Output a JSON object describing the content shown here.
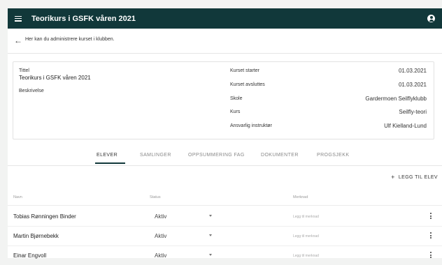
{
  "appbar": {
    "title": "Teorikurs i GSFK våren 2021",
    "menu_icon": "menu-icon",
    "account_icon": "account-circle-icon",
    "color": "#11383a"
  },
  "back": {
    "text": "Her kan du administrere kurset i klubben.",
    "icon": "arrow-left-icon"
  },
  "details": {
    "title_label": "Tittel",
    "title_value": "Teorikurs i GSFK våren 2021",
    "description_label": "Beskrivelse",
    "fields": [
      {
        "label": "Kurset starter",
        "value": "01.03.2021"
      },
      {
        "label": "Kurset avsluttes",
        "value": "01.03.2021"
      },
      {
        "label": "Skole",
        "value": "Gardermoen Seilflyklubb"
      },
      {
        "label": "Kurs",
        "value": "Seilfly-teori"
      },
      {
        "label": "Ansvarlig instruktør",
        "value": "Ulf Kielland-Lund"
      }
    ]
  },
  "tabs": [
    {
      "label": "ELEVER",
      "active": true
    },
    {
      "label": "SAMLINGER",
      "active": false
    },
    {
      "label": "OPPSUMMERING FAG",
      "active": false
    },
    {
      "label": "DOKUMENTER",
      "active": false
    },
    {
      "label": "PROGSJEKK",
      "active": false
    }
  ],
  "add_button": {
    "label": "LEGG TIL ELEV",
    "icon": "plus-icon"
  },
  "table": {
    "headers": {
      "name": "Navn",
      "status": "Status",
      "note": "Merknad"
    },
    "rows": [
      {
        "name": "Tobias Rønningen Binder",
        "status": "Aktiv",
        "note": "Legg til merknad"
      },
      {
        "name": "Martin Bjørnebekk",
        "status": "Aktiv",
        "note": "Legg til merknad"
      },
      {
        "name": "Einar Engvoll",
        "status": "Aktiv",
        "note": "Legg til merknad"
      }
    ]
  }
}
